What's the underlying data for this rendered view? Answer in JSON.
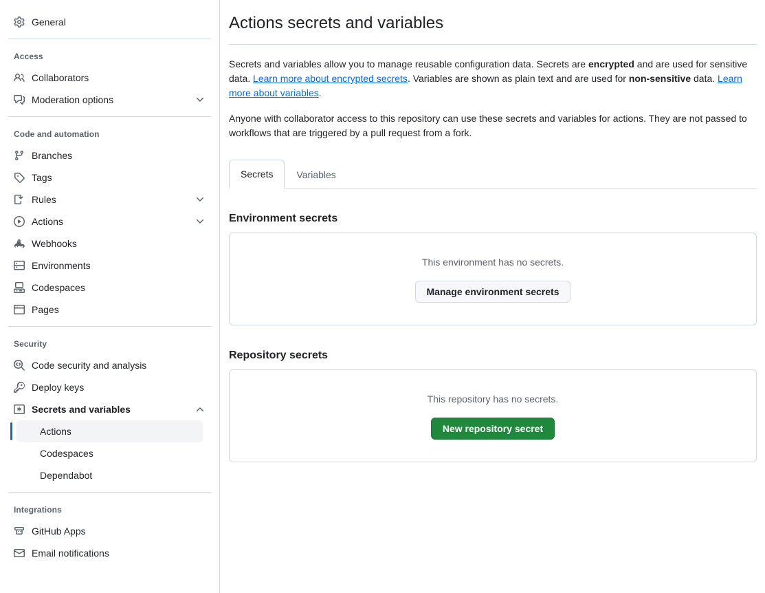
{
  "sidebar": {
    "groups": [
      {
        "id": "top",
        "title": null,
        "items": [
          {
            "label": "General",
            "icon": "gear-icon",
            "expandable": false,
            "name": "general"
          }
        ]
      },
      {
        "id": "access",
        "title": "Access",
        "items": [
          {
            "label": "Collaborators",
            "icon": "people-icon",
            "expandable": false,
            "name": "collaborators"
          },
          {
            "label": "Moderation options",
            "icon": "comment-discussion-icon",
            "expandable": true,
            "expanded": false,
            "name": "moderation-options"
          }
        ]
      },
      {
        "id": "code-and-automation",
        "title": "Code and automation",
        "items": [
          {
            "label": "Branches",
            "icon": "git-branch-icon",
            "expandable": false,
            "name": "branches"
          },
          {
            "label": "Tags",
            "icon": "tag-icon",
            "expandable": false,
            "name": "tags"
          },
          {
            "label": "Rules",
            "icon": "rules-icon",
            "expandable": true,
            "expanded": false,
            "name": "rules"
          },
          {
            "label": "Actions",
            "icon": "play-circle-icon",
            "expandable": true,
            "expanded": false,
            "name": "actions"
          },
          {
            "label": "Webhooks",
            "icon": "webhook-icon",
            "expandable": false,
            "name": "webhooks"
          },
          {
            "label": "Environments",
            "icon": "server-icon",
            "expandable": false,
            "name": "environments"
          },
          {
            "label": "Codespaces",
            "icon": "codespaces-icon",
            "expandable": false,
            "name": "codespaces"
          },
          {
            "label": "Pages",
            "icon": "browser-icon",
            "expandable": false,
            "name": "pages"
          }
        ]
      },
      {
        "id": "security",
        "title": "Security",
        "items": [
          {
            "label": "Code security and analysis",
            "icon": "codescan-icon",
            "expandable": false,
            "name": "code-security-and-analysis"
          },
          {
            "label": "Deploy keys",
            "icon": "key-icon",
            "expandable": false,
            "name": "deploy-keys"
          },
          {
            "label": "Secrets and variables",
            "icon": "asterisk-icon",
            "expandable": true,
            "expanded": true,
            "bold": true,
            "name": "secrets-and-variables"
          }
        ],
        "subitems": [
          {
            "label": "Actions",
            "active": true,
            "name": "actions"
          },
          {
            "label": "Codespaces",
            "active": false,
            "name": "codespaces"
          },
          {
            "label": "Dependabot",
            "active": false,
            "name": "dependabot"
          }
        ]
      },
      {
        "id": "integrations",
        "title": "Integrations",
        "items": [
          {
            "label": "GitHub Apps",
            "icon": "github-apps-icon",
            "expandable": false,
            "name": "github-apps"
          },
          {
            "label": "Email notifications",
            "icon": "mail-icon",
            "expandable": false,
            "name": "email-notifications"
          }
        ]
      }
    ]
  },
  "main": {
    "title": "Actions secrets and variables",
    "paragraph1": {
      "part1": "Secrets and variables allow you to manage reusable configuration data. Secrets are ",
      "bold1": "encrypted",
      "part2": " and are used for sensitive data. ",
      "link1": "Learn more about encrypted secrets",
      "part3": ". Variables are shown as plain text and are used for ",
      "bold2": "non-sensitive",
      "part4": " data. ",
      "link2": "Learn more about variables",
      "part5": "."
    },
    "paragraph2": "Anyone with collaborator access to this repository can use these secrets and variables for actions. They are not passed to workflows that are triggered by a pull request from a fork.",
    "tabs": [
      {
        "label": "Secrets",
        "active": true,
        "name": "secrets"
      },
      {
        "label": "Variables",
        "active": false,
        "name": "variables"
      }
    ],
    "environment_section": {
      "title": "Environment secrets",
      "empty_text": "This environment has no secrets.",
      "button_label": "Manage environment secrets"
    },
    "repository_section": {
      "title": "Repository secrets",
      "empty_text": "This repository has no secrets.",
      "button_label": "New repository secret"
    }
  },
  "colors": {
    "accent": "#0969da",
    "success": "#1f883d",
    "border": "#d1d9e0",
    "muted_text": "#59636e",
    "text": "#1f2328"
  }
}
